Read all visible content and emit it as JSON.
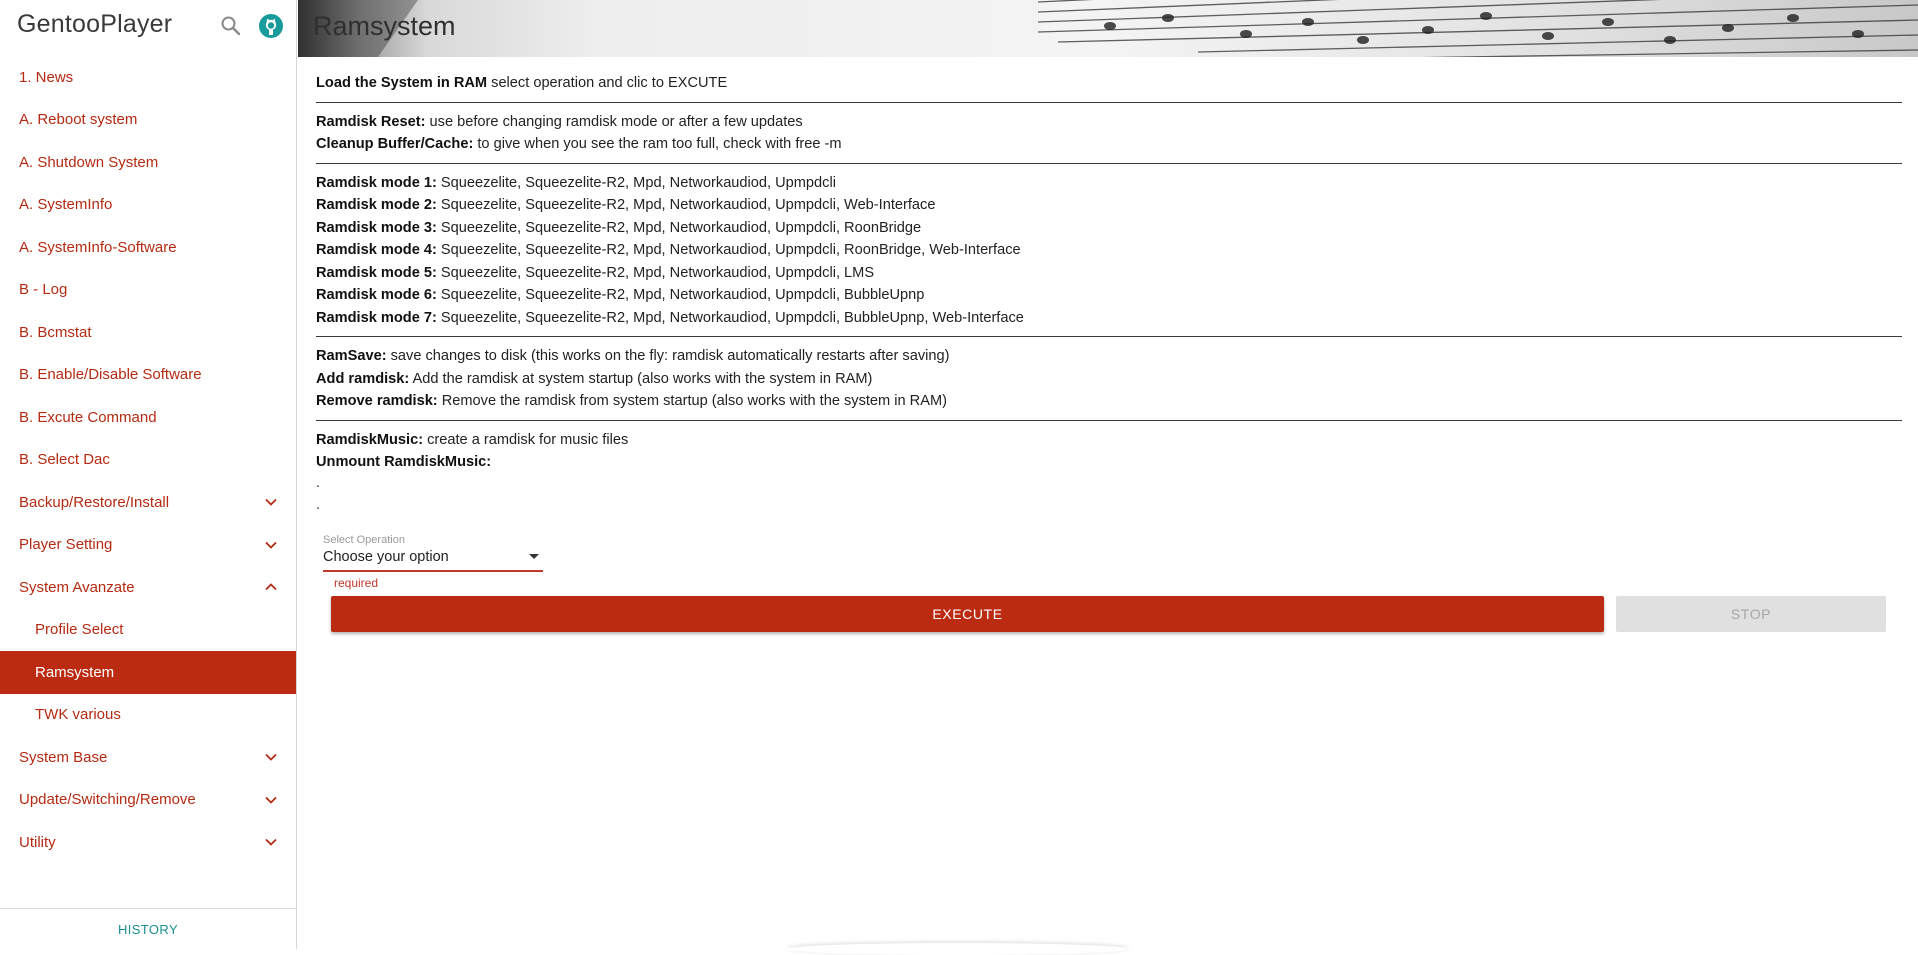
{
  "sidebar": {
    "app_title": "GentooPlayer",
    "items": [
      {
        "label": "1. News"
      },
      {
        "label": "A. Reboot system"
      },
      {
        "label": "A. Shutdown System"
      },
      {
        "label": "A. SystemInfo"
      },
      {
        "label": "A. SystemInfo-Software"
      },
      {
        "label": "B - Log"
      },
      {
        "label": "B. Bcmstat"
      },
      {
        "label": "B. Enable/Disable Software"
      },
      {
        "label": "B. Excute Command"
      },
      {
        "label": "B. Select Dac"
      },
      {
        "label": "Backup/Restore/Install"
      },
      {
        "label": "Player Setting"
      },
      {
        "label": "System Avanzate"
      },
      {
        "label": "Profile Select"
      },
      {
        "label": "Ramsystem"
      },
      {
        "label": "TWK various"
      },
      {
        "label": "System Base"
      },
      {
        "label": "Update/Switching/Remove"
      },
      {
        "label": "Utility"
      }
    ],
    "history_label": "HISTORY"
  },
  "main": {
    "title": "Ramsystem",
    "intro": {
      "bold": "Load the System in RAM",
      "text": " select operation and clic to EXCUTE"
    },
    "section1": [
      {
        "bold": "Ramdisk Reset:",
        "text": " use before changing ramdisk mode or after a few updates"
      },
      {
        "bold": "Cleanup Buffer/Cache:",
        "text": " to give when you see the ram too full, check with free -m"
      }
    ],
    "modes": [
      {
        "bold": "Ramdisk mode 1:",
        "text": " Squeezelite, Squeezelite-R2, Mpd, Networkaudiod, Upmpdcli"
      },
      {
        "bold": "Ramdisk mode 2:",
        "text": " Squeezelite, Squeezelite-R2, Mpd, Networkaudiod, Upmpdcli, Web-Interface"
      },
      {
        "bold": "Ramdisk mode 3:",
        "text": " Squeezelite, Squeezelite-R2, Mpd, Networkaudiod, Upmpdcli, RoonBridge"
      },
      {
        "bold": "Ramdisk mode 4:",
        "text": " Squeezelite, Squeezelite-R2, Mpd, Networkaudiod, Upmpdcli, RoonBridge, Web-Interface"
      },
      {
        "bold": "Ramdisk mode 5:",
        "text": " Squeezelite, Squeezelite-R2, Mpd, Networkaudiod, Upmpdcli, LMS"
      },
      {
        "bold": "Ramdisk mode 6:",
        "text": " Squeezelite, Squeezelite-R2, Mpd, Networkaudiod, Upmpdcli, BubbleUpnp"
      },
      {
        "bold": "Ramdisk mode 7:",
        "text": " Squeezelite, Squeezelite-R2, Mpd, Networkaudiod, Upmpdcli, BubbleUpnp, Web-Interface"
      }
    ],
    "section3": [
      {
        "bold": "RamSave:",
        "text": " save changes to disk (this works on the fly: ramdisk automatically restarts after saving)"
      },
      {
        "bold": "Add ramdisk:",
        "text": " Add the ramdisk at system startup (also works with the system in RAM)"
      },
      {
        "bold": "Remove ramdisk:",
        "text": " Remove the ramdisk from system startup (also works with the system in RAM)"
      }
    ],
    "section4": [
      {
        "bold": "RamdiskMusic:",
        "text": " create a ramdisk for music files"
      },
      {
        "bold": "Unmount RamdiskMusic:",
        "text": ""
      }
    ],
    "dots": [
      ".",
      "."
    ],
    "select": {
      "label": "Select Operation",
      "value": "Choose your option",
      "error": "required"
    },
    "execute_label": "EXECUTE",
    "stop_label": "STOP"
  },
  "colors": {
    "accent": "#bb2b12",
    "link": "#b52a12",
    "history": "#1a8f8f"
  }
}
